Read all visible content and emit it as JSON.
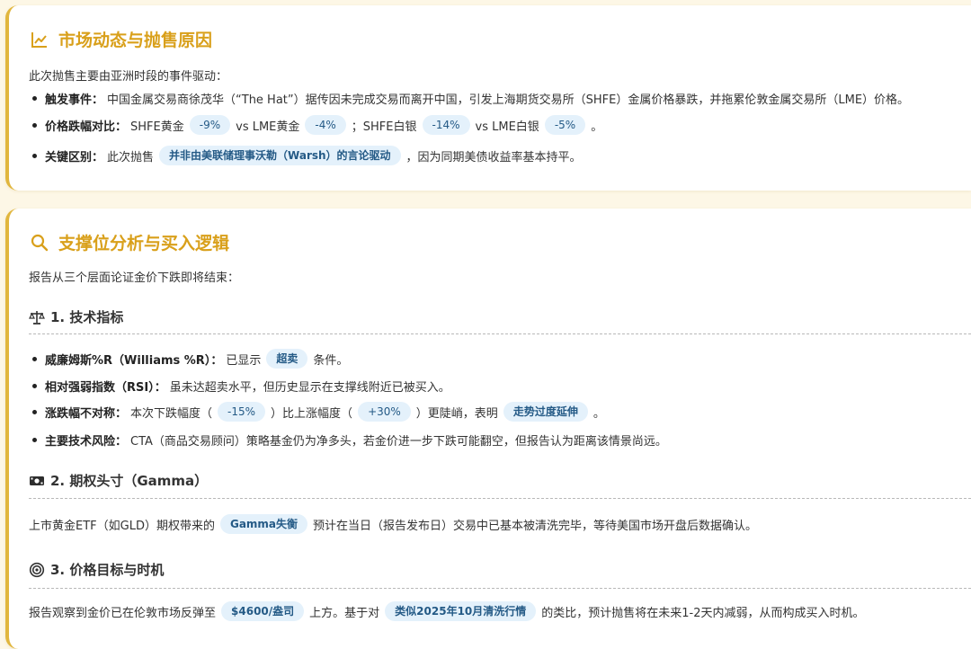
{
  "section1": {
    "title": "市场动态与抛售原因",
    "icon": "chart-line-icon",
    "intro": "此次抛售主要由亚洲时段的事件驱动：",
    "items": {
      "trigger": {
        "label": "触发事件：",
        "text": "中国金属交易商徐茂华（“The Hat”）据传因未完成交易而离开中国，引发上海期货交易所（SHFE）金属价格暴跌，并拖累伦敦金属交易所（LME）价格。"
      },
      "compare": {
        "label": "价格跌幅对比：",
        "t1": "SHFE黄金",
        "v1": "-9%",
        "t2": "vs LME黄金",
        "v2": "-4%",
        "t3": "；SHFE白银",
        "v3": "-14%",
        "t4": "vs LME白银",
        "v4": "-5%",
        "t5": "。"
      },
      "key": {
        "label": "关键区别：",
        "t1": "此次抛售",
        "tag": "并非由美联储理事沃勒（Warsh）的言论驱动",
        "t2": "，因为同期美债收益率基本持平。"
      }
    }
  },
  "section2": {
    "title": "支撑位分析与买入逻辑",
    "icon": "search-icon",
    "intro": "报告从三个层面论证金价下跌即将结束：",
    "sub1": {
      "icon": "balance-scale-icon",
      "title": "1. 技术指标",
      "williams": {
        "label": "威廉姆斯%R（Williams %R）：",
        "t1": "已显示",
        "tag": "超卖",
        "t2": "条件。"
      },
      "rsi": {
        "label": "相对强弱指数（RSI）：",
        "text": "虽未达超卖水平，但历史显示在支撑线附近已被买入。"
      },
      "asym": {
        "label": "涨跌幅不对称：",
        "t1": "本次下跌幅度（",
        "v1": "-15%",
        "t2": "）比上涨幅度（",
        "v2": "+30%",
        "t3": "）更陡峭，表明",
        "tag": "走势过度延伸",
        "t4": "。"
      },
      "risk": {
        "label": "主要技术风险：",
        "text": "CTA（商品交易顾问）策略基金仍为净多头，若金价进一步下跌可能翻空，但报告认为距离该情景尚远。"
      }
    },
    "sub2": {
      "icon": "money-icon",
      "title": "2. 期权头寸（Gamma）",
      "t1": "上市黄金ETF（如GLD）期权带来的",
      "tag": "Gamma失衡",
      "t2": "预计在当日（报告发布日）交易中已基本被清洗完毕，等待美国市场开盘后数据确认。"
    },
    "sub3": {
      "icon": "target-icon",
      "title": "3. 价格目标与时机",
      "t1": "报告观察到金价已在伦敦市场反弹至",
      "tag1": "$4600/盎司",
      "t2": "上方。基于对",
      "tag2": "类似2025年10月清洗行情",
      "t3": "的类比，预计抛售将在未来1-2天内减弱，从而构成买入时机。"
    }
  }
}
